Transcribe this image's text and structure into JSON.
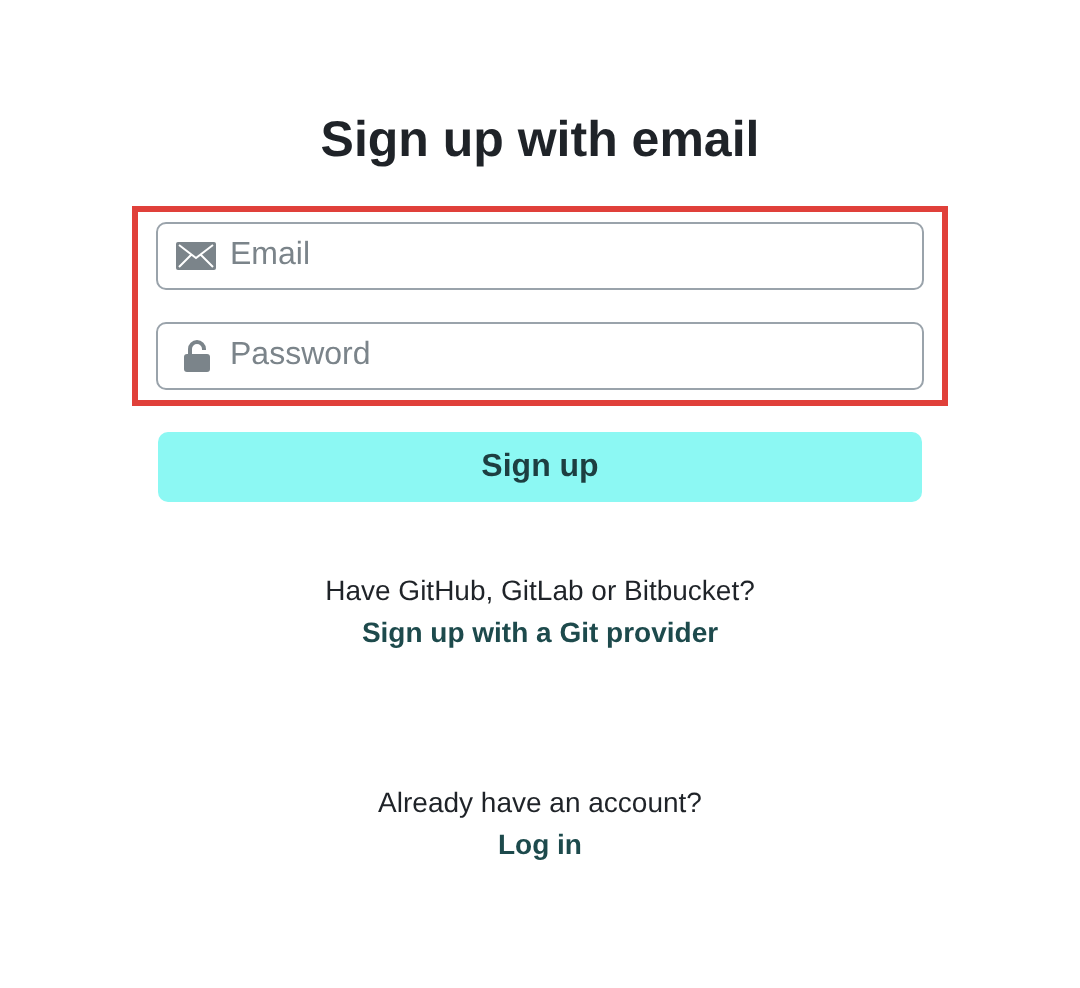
{
  "title": "Sign up with email",
  "fields": [
    {
      "kind": "email",
      "placeholder": "Email"
    },
    {
      "kind": "password",
      "placeholder": "Password"
    }
  ],
  "submit_button": "Sign up",
  "git_prompt": {
    "text": "Have GitHub, GitLab or Bitbucket?",
    "link": "Sign up with a Git provider"
  },
  "login_prompt": {
    "text": "Already have an account?",
    "link": "Log in"
  }
}
